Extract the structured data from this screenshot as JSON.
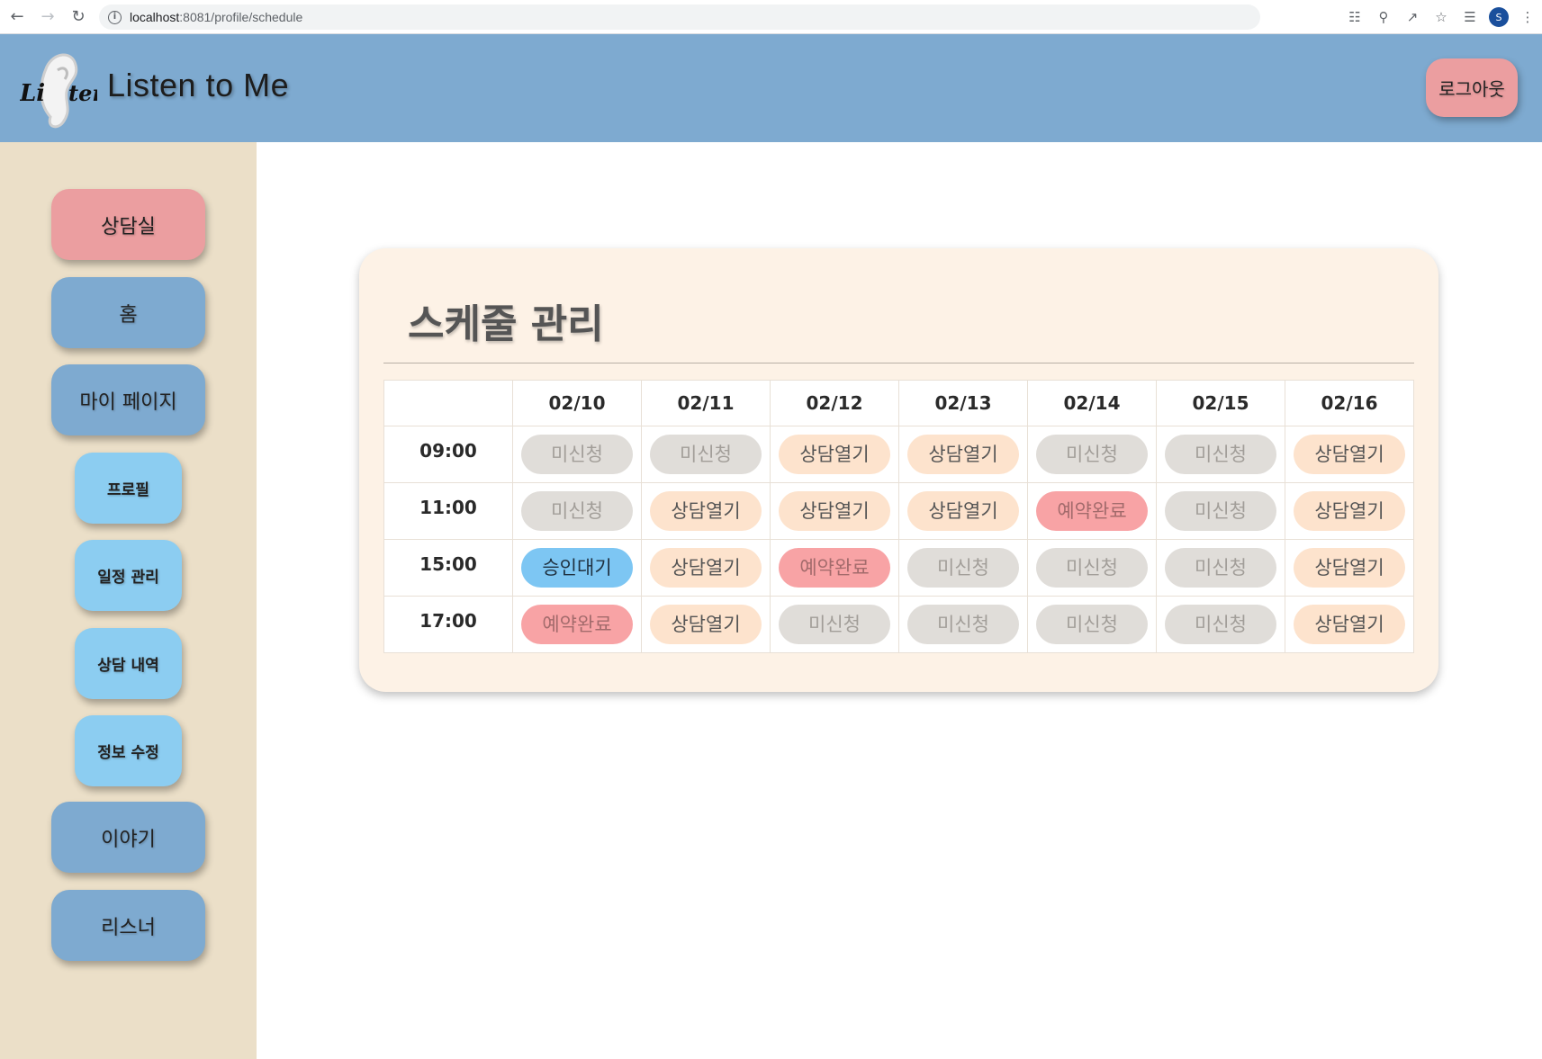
{
  "browser": {
    "url_host": "localhost",
    "url_path": ":8081/profile/schedule",
    "profile_initial": "S"
  },
  "header": {
    "title": "Listen to Me",
    "logo_text": "Li ten",
    "logout_label": "로그아웃"
  },
  "sidebar": {
    "items": [
      {
        "label": "상담실",
        "kind": "big",
        "active": true
      },
      {
        "label": "홈",
        "kind": "big"
      },
      {
        "label": "마이 페이지",
        "kind": "big"
      },
      {
        "label": "프로필",
        "kind": "sub"
      },
      {
        "label": "일정 관리",
        "kind": "sub"
      },
      {
        "label": "상담 내역",
        "kind": "sub"
      },
      {
        "label": "정보 수정",
        "kind": "sub"
      },
      {
        "label": "이야기",
        "kind": "big"
      },
      {
        "label": "리스너",
        "kind": "big"
      }
    ]
  },
  "schedule": {
    "title": "스케줄 관리",
    "dates": [
      "02/10",
      "02/11",
      "02/12",
      "02/13",
      "02/14",
      "02/15",
      "02/16"
    ],
    "rows": [
      {
        "time": "09:00",
        "slots": [
          "미신청",
          "미신청",
          "상담열기",
          "상담열기",
          "미신청",
          "미신청",
          "상담열기"
        ]
      },
      {
        "time": "11:00",
        "slots": [
          "미신청",
          "상담열기",
          "상담열기",
          "상담열기",
          "예약완료",
          "미신청",
          "상담열기"
        ]
      },
      {
        "time": "15:00",
        "slots": [
          "승인대기",
          "상담열기",
          "예약완료",
          "미신청",
          "미신청",
          "미신청",
          "상담열기"
        ]
      },
      {
        "time": "17:00",
        "slots": [
          "예약완료",
          "상담열기",
          "미신청",
          "미신청",
          "미신청",
          "미신청",
          "상담열기"
        ]
      }
    ],
    "status_colors": {
      "미신청": "#e0ddd9",
      "상담열기": "#fde3cd",
      "예약완료": "#f8a3a5",
      "승인대기": "#7dc6f3"
    }
  }
}
